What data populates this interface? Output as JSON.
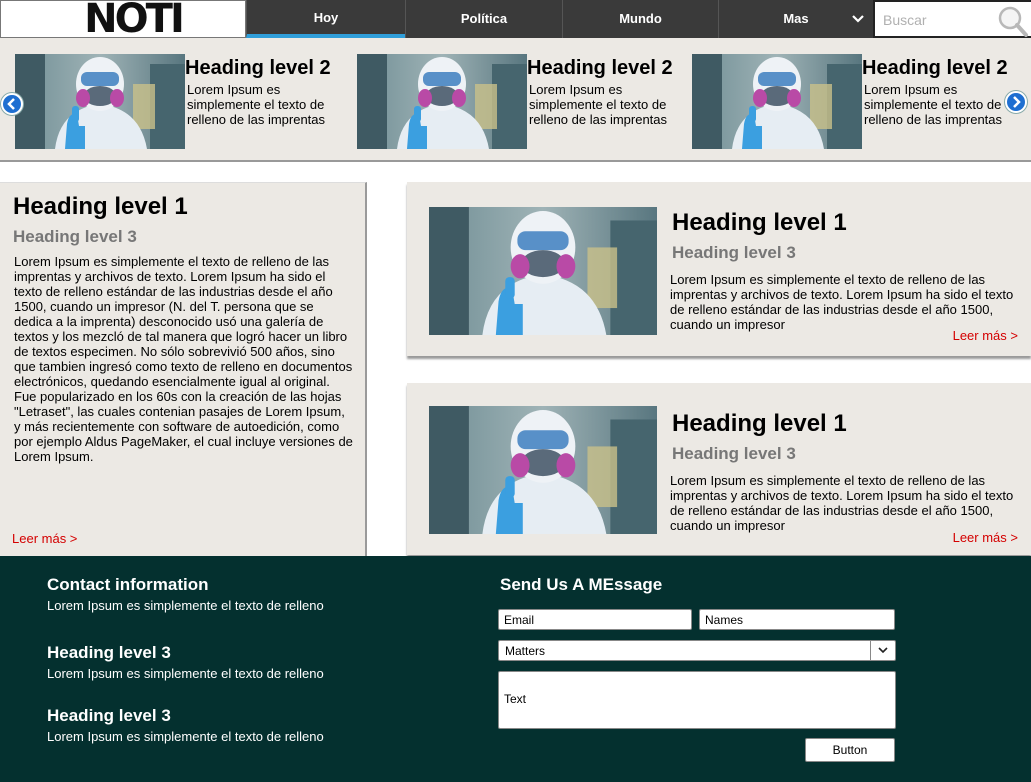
{
  "header": {
    "logo": "NOTI",
    "nav": [
      {
        "label": "Hoy",
        "active": true
      },
      {
        "label": "Política",
        "active": false
      },
      {
        "label": "Mundo",
        "active": false
      },
      {
        "label": "Mas",
        "active": false
      }
    ],
    "search": {
      "placeholder": "Buscar",
      "value": ""
    }
  },
  "carousel": {
    "items": [
      {
        "heading": "Heading level 2",
        "text": "Lorem Ipsum es simplemente el texto de relleno de las imprentas",
        "image": "scientist-photo"
      },
      {
        "heading": "Heading level 2",
        "text": "Lorem Ipsum es simplemente el texto de relleno de las imprentas",
        "image": "scientist-photo"
      },
      {
        "heading": "Heading level 2",
        "text": "Lorem Ipsum es simplemente el texto de relleno de las imprentas",
        "image": "scientist-photo"
      }
    ],
    "prev_icon": "chevron-left-icon",
    "next_icon": "chevron-right-icon"
  },
  "featured": {
    "heading": "Heading level 1",
    "subheading": "Heading level 3",
    "text": "Lorem Ipsum es simplemente el texto de relleno de las imprentas y archivos de texto. Lorem Ipsum ha sido el texto de relleno estándar de las industrias desde el año 1500, cuando un impresor (N. del T. persona que se dedica a la imprenta) desconocido usó una galería de textos y los mezcló de tal manera que logró hacer un libro de textos especimen. No sólo sobrevivió 500 años, sino que tambien ingresó como texto de relleno en documentos electrónicos, quedando esencialmente igual al original. Fue popularizado en los 60s con la creación de las hojas \"Letraset\", las cuales contenian pasajes de Lorem Ipsum, y más recientemente con software de autoedición, como por ejemplo Aldus PageMaker, el cual incluye versiones de Lorem Ipsum.",
    "read_more": "Leer más >"
  },
  "articles": [
    {
      "heading": "Heading level 1",
      "subheading": "Heading level 3",
      "text": "Lorem Ipsum es simplemente el texto de relleno de las imprentas y archivos de texto. Lorem Ipsum ha sido el texto de relleno estándar de las industrias desde el año 1500, cuando un impresor",
      "read_more": "Leer más >"
    },
    {
      "heading": "Heading level 1",
      "subheading": "Heading level 3",
      "text": "Lorem Ipsum es simplemente el texto de relleno de las imprentas y archivos de texto. Lorem Ipsum ha sido el texto de relleno estándar de las industrias desde el año 1500, cuando un impresor",
      "read_more": "Leer más >"
    }
  ],
  "footer": {
    "contact": [
      {
        "heading": "Contact information",
        "text": "Lorem Ipsum es simplemente el texto de relleno"
      },
      {
        "heading": "Heading level 3",
        "text": "Lorem Ipsum es simplemente el texto de relleno"
      },
      {
        "heading": "Heading level 3",
        "text": "Lorem Ipsum es simplemente el texto de relleno"
      }
    ],
    "form": {
      "title": "Send Us A MEssage",
      "email_placeholder": "Email",
      "names_placeholder": "Names",
      "matters_value": "Matters",
      "text_placeholder": "Text",
      "button_label": "Button"
    }
  },
  "colors": {
    "nav_bg": "#3a3a3a",
    "nav_active": "#2f9ed9",
    "panel_bg": "#ece9e4",
    "footer_bg": "#04302f",
    "link_red": "#d40000",
    "arrow_blue": "#1f6fd1"
  }
}
